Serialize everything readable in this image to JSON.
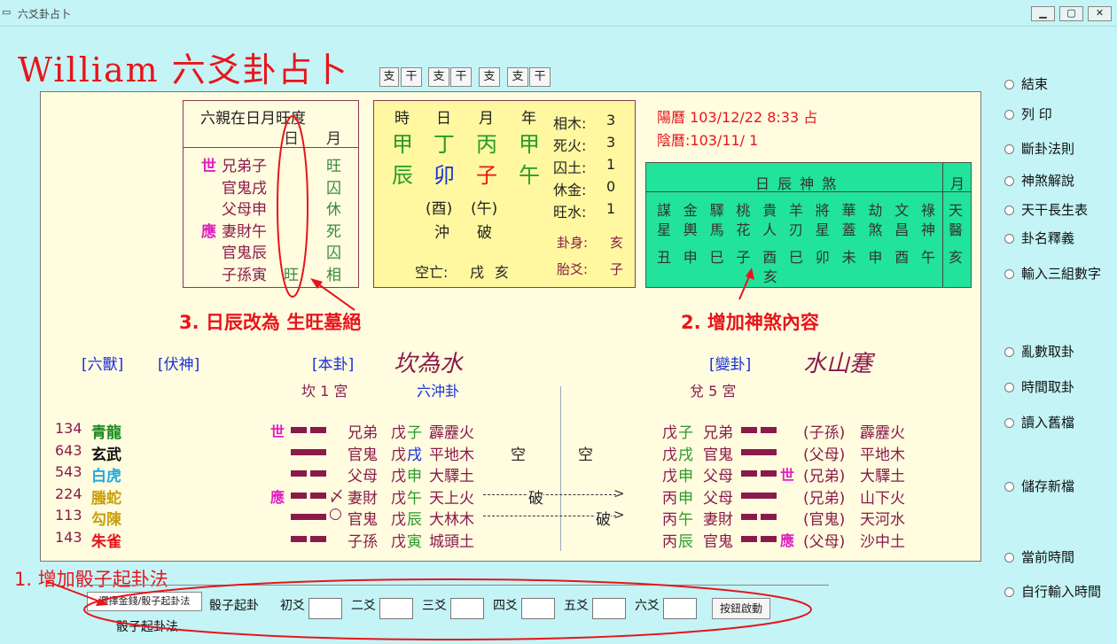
{
  "window": {
    "title": "六爻卦占卜",
    "min": "▁",
    "max": "▢",
    "close": "✕"
  },
  "app_title": "William 六爻卦占卜",
  "gz_buttons": [
    "支",
    "干",
    "支",
    "干",
    "支",
    "支",
    "干"
  ],
  "liuqin": {
    "title": "六親在日月旺度",
    "col_day": "日",
    "col_month": "月",
    "rows": [
      {
        "mark": "世",
        "name": "兄弟子",
        "day": "",
        "month": "旺"
      },
      {
        "mark": "",
        "name": "官鬼戌",
        "day": "",
        "month": "囚"
      },
      {
        "mark": "",
        "name": "父母申",
        "day": "",
        "month": "休"
      },
      {
        "mark": "應",
        "name": "妻財午",
        "day": "",
        "month": "死"
      },
      {
        "mark": "",
        "name": "官鬼辰",
        "day": "",
        "month": "囚"
      },
      {
        "mark": "",
        "name": "子孫寅",
        "day": "旺",
        "month": "相"
      }
    ]
  },
  "ganzhi": {
    "headers": [
      "時",
      "日",
      "月",
      "年"
    ],
    "gan": [
      "甲",
      "丁",
      "丙",
      "甲"
    ],
    "zhi": [
      "辰",
      "卯",
      "子",
      "午"
    ],
    "xun1": "(酉)",
    "xun2": "(午)",
    "chong": "沖",
    "po": "破",
    "kongwang": "空亡:",
    "kw1": "戌",
    "kw2": "亥",
    "wuxing": [
      "相木:",
      "死火:",
      "囚土:",
      "休金:",
      "旺水:"
    ],
    "wx_vals": [
      "3",
      "3",
      "1",
      "0",
      "1"
    ],
    "guashen": "卦身:",
    "guashen_v": "亥",
    "taiyao": "胎爻:",
    "taiyao_v": "子"
  },
  "dates": {
    "solar": "陽曆 103/12/22 8:33 占",
    "lunar": "陰曆:103/11/ 1"
  },
  "shensha": {
    "title": "日 辰 神 煞",
    "month": "月",
    "names": [
      [
        "謀",
        "星"
      ],
      [
        "金",
        "輿"
      ],
      [
        "驛",
        "馬"
      ],
      [
        "桃",
        "花"
      ],
      [
        "貴",
        "人"
      ],
      [
        "羊",
        "刃"
      ],
      [
        "將",
        "星"
      ],
      [
        "華",
        "蓋"
      ],
      [
        "劫",
        "煞"
      ],
      [
        "文",
        "昌"
      ],
      [
        "祿",
        "神"
      ]
    ],
    "month_name": [
      "天",
      "醫"
    ],
    "vals": [
      "丑",
      "申",
      "巳",
      "子",
      "酉",
      "巳",
      "卯",
      "未",
      "申",
      "酉",
      "午"
    ],
    "extra": "亥",
    "month_val": "亥"
  },
  "annotations": {
    "a3": "3. 日辰改為 生旺墓絕",
    "a2": "2. 增加神煞內容",
    "a1": "1. 增加骰子起卦法"
  },
  "labels": {
    "liushou": "[六獸]",
    "fushen": "[伏神]",
    "bengua": "[本卦]",
    "biangua": "[變卦]",
    "ben_name": "坎為水",
    "bian_name": "水山蹇",
    "ben_palace": "坎 1 宮",
    "liuchong": "六沖卦",
    "bian_palace": "兌 5 宮"
  },
  "lines": [
    {
      "num": "134",
      "beast": "青龍",
      "bc": "#1f8a1f",
      "shi": "世",
      "yin": true,
      "mark": "",
      "rel": "兄弟",
      "gz1": "戊",
      "gz2": "子",
      "gc": "#2a9a2a",
      "na": "霹靂火",
      "kong": "",
      "kong2": "",
      "po": "",
      "bgz1": "戊",
      "bgz2": "子",
      "brel": "兄弟",
      "byin": true,
      "bshi": "",
      "bfu": "(子孫)",
      "bna": "霹靂火"
    },
    {
      "num": "643",
      "beast": "玄武",
      "bc": "#111111",
      "shi": "",
      "yin": false,
      "mark": "",
      "rel": "官鬼",
      "gz1": "戊",
      "gz2": "戌",
      "gc": "#1a2fd8",
      "na": "平地木",
      "kong": "空",
      "kong2": "空",
      "po": "",
      "bgz1": "戊",
      "bgz2": "戌",
      "brel": "官鬼",
      "byin": false,
      "bshi": "",
      "bfu": "(父母)",
      "bna": "平地木"
    },
    {
      "num": "543",
      "beast": "白虎",
      "bc": "#22aadd",
      "shi": "",
      "yin": true,
      "mark": "",
      "rel": "父母",
      "gz1": "戊",
      "gz2": "申",
      "gc": "#2a9a2a",
      "na": "大驛土",
      "kong": "",
      "kong2": "",
      "po": "",
      "bgz1": "戊",
      "bgz2": "申",
      "brel": "父母",
      "byin": true,
      "bshi": "世",
      "bfu": "(兄弟)",
      "bna": "大驛土"
    },
    {
      "num": "224",
      "beast": "螣蛇",
      "bc": "#c8a010",
      "shi": "應",
      "yin": true,
      "mark": "〆",
      "rel": "妻財",
      "gz1": "戊",
      "gz2": "午",
      "gc": "#2a9a2a",
      "na": "天上火",
      "kong": "",
      "kong2": "",
      "po": "破",
      "bgz1": "丙",
      "bgz2": "申",
      "brel": "父母",
      "byin": false,
      "bshi": "",
      "bfu": "(兄弟)",
      "bna": "山下火"
    },
    {
      "num": "113",
      "beast": "勾陳",
      "bc": "#c8a010",
      "shi": "",
      "yin": false,
      "mark": "○",
      "rel": "官鬼",
      "gz1": "戊",
      "gz2": "辰",
      "gc": "#2a9a2a",
      "na": "大林木",
      "kong": "",
      "kong2": "",
      "po": "破",
      "bgz1": "丙",
      "bgz2": "午",
      "brel": "妻財",
      "byin": true,
      "bshi": "",
      "bfu": "(官鬼)",
      "bna": "天河水"
    },
    {
      "num": "143",
      "beast": "朱雀",
      "bc": "#e8141b",
      "shi": "",
      "yin": true,
      "mark": "",
      "rel": "子孫",
      "gz1": "戊",
      "gz2": "寅",
      "gc": "#2a9a2a",
      "na": "城頭土",
      "kong": "",
      "kong2": "",
      "po": "",
      "bgz1": "丙",
      "bgz2": "辰",
      "brel": "官鬼",
      "byin": true,
      "bshi": "應",
      "bfu": "(父母)",
      "bna": "沙中土"
    }
  ],
  "radios": [
    "結束",
    "列 印",
    "斷卦法則",
    "神煞解說",
    "天干長生表",
    "卦名釋義",
    "輸入三組數字",
    "亂數取卦",
    "時間取卦",
    "讀入舊檔",
    "儲存新檔",
    "當前時間",
    "自行輸入時間"
  ],
  "bottom": {
    "select_btn": "選擇金錢/骰子起卦法",
    "dice_label": "骰子起卦",
    "y1": "初爻",
    "y2": "二爻",
    "y3": "三爻",
    "y4": "四爻",
    "y5": "五爻",
    "y6": "六爻",
    "start": "按鈕啟動",
    "method": "骰子起卦法"
  }
}
